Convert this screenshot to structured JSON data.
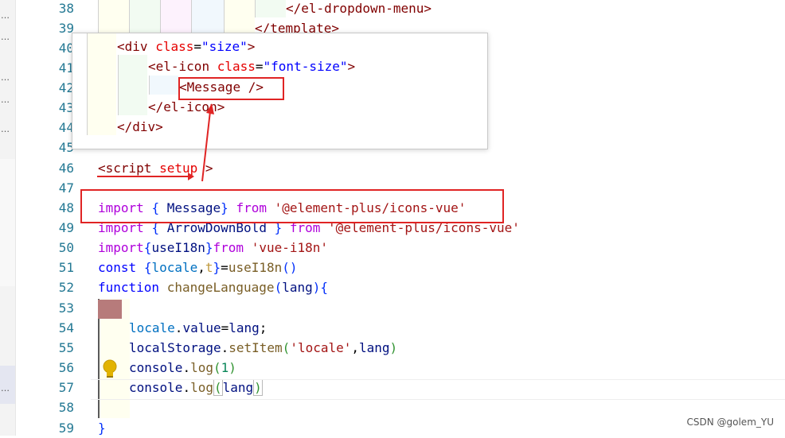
{
  "editor": {
    "line_numbers": [
      "38",
      "39",
      "40",
      "41",
      "42",
      "43",
      "44",
      "45",
      "46",
      "47",
      "48",
      "49",
      "50",
      "51",
      "52",
      "53",
      "54",
      "55",
      "56",
      "57",
      "58",
      "59"
    ],
    "code": {
      "l38": "</el-dropdown-menu>",
      "l39": "</template>",
      "l46_open": "<",
      "l46_tag": "script",
      "l46_attr": "setup",
      "l46_close": ">",
      "l48_kw": "import",
      "l48_brace_open": "{",
      "l48_name": "Message",
      "l48_brace_close": "}",
      "l48_from": "from",
      "l48_str": "'@element-plus/icons-vue'",
      "l49_kw": "import",
      "l49_brace_open": "{",
      "l49_name": "ArrowDownBold",
      "l49_brace_close": "}",
      "l49_from": "from",
      "l49_str": "'@element-plus/icons-vue'",
      "l50_kw": "import",
      "l50_brace_open": "{",
      "l50_name": "useI18n",
      "l50_brace_close": "}",
      "l50_from": "from",
      "l50_str": "'vue-i18n'",
      "l51_kw": "const",
      "l51_brace_open": "{",
      "l51_a": "locale",
      "l51_comma": ",",
      "l51_b": "t",
      "l51_brace_close": "}",
      "l51_eq": "=",
      "l51_fn": "useI18n",
      "l51_paren": "()",
      "l52_kw": "function",
      "l52_fn": "changeLanguage",
      "l52_p_open": "(",
      "l52_param": "lang",
      "l52_p_close": ")",
      "l52_brace": "{",
      "l54_var": "locale",
      "l54_dot": ".",
      "l54_prop": "value",
      "l54_eq": "=",
      "l54_val": "lang",
      "l54_semi": ";",
      "l55_var": "localStorage",
      "l55_dot": ".",
      "l55_fn": "setItem",
      "l55_p_open": "(",
      "l55_str": "'locale'",
      "l55_comma": ",",
      "l55_arg": "lang",
      "l55_p_close": ")",
      "l56_var": "console",
      "l56_dot": ".",
      "l56_fn": "log",
      "l56_p_open": "(",
      "l56_num": "1",
      "l56_p_close": ")",
      "l57_var": "console",
      "l57_dot": ".",
      "l57_fn": "log",
      "l57_p_open": "(",
      "l57_arg": "lang",
      "l57_p_close": ")",
      "l59": "}"
    }
  },
  "hover_popup": {
    "line_numbers": [
      "40",
      "41",
      "42",
      "43",
      "44"
    ],
    "l40_open": "<",
    "l40_tag": "div",
    "l40_attr": "class",
    "l40_eq": "=",
    "l40_str": "\"size\"",
    "l40_close": ">",
    "l41_open": "<",
    "l41_tag": "el-icon",
    "l41_attr": "class",
    "l41_eq": "=",
    "l41_str": "\"font-size\"",
    "l41_close": ">",
    "l42_open": "<",
    "l42_tag": "Message",
    "l42_close": " />",
    "l43_open": "</",
    "l43_tag": "el-icon",
    "l43_close": ">",
    "l44_open": "</",
    "l44_tag": "div",
    "l44_close": ">"
  },
  "watermark": "CSDN @golem_YU",
  "colors": {
    "line_number": "#237893",
    "annotation_red": "#e02424",
    "tag": "#800000",
    "keyword": "#af00db",
    "string": "#a31515"
  }
}
